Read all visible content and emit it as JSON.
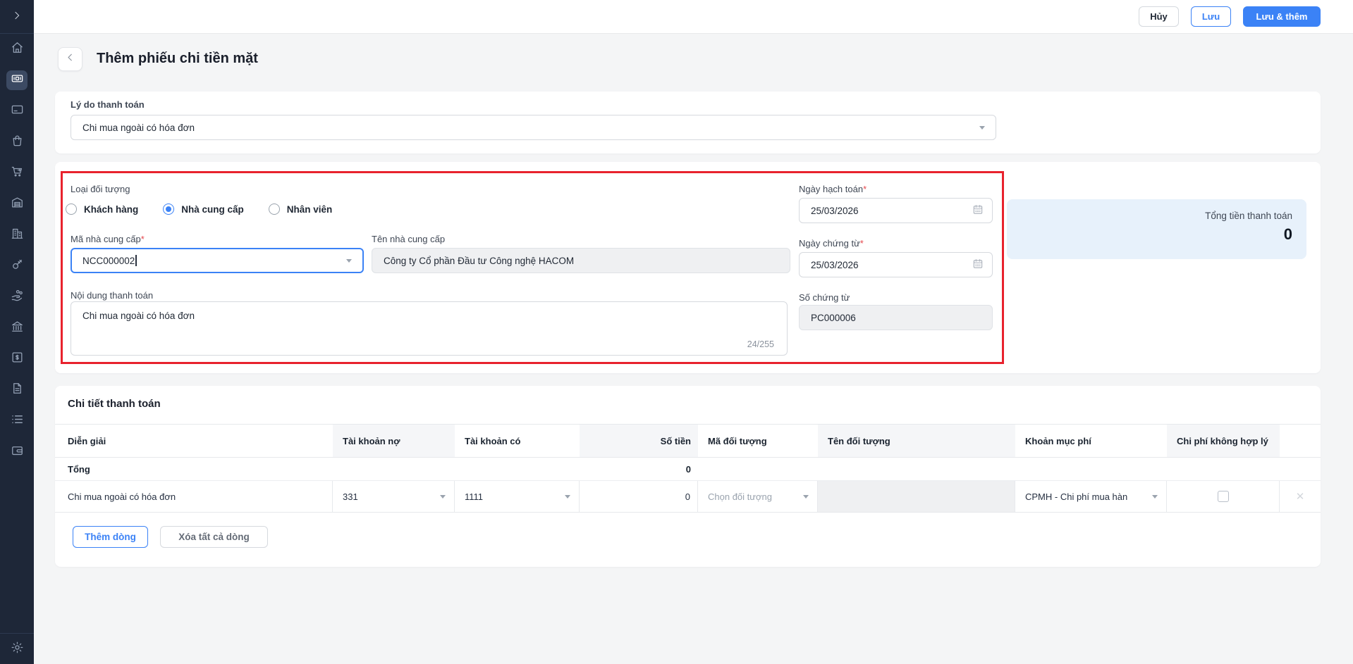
{
  "colors": {
    "accent": "#3b82f6",
    "sidebar_bg": "#1e2738",
    "annotation_red": "#e8222d",
    "total_panel_bg": "#e7f1fb"
  },
  "topbar": {
    "cancel_label": "Hủy",
    "save_label": "Lưu",
    "save_add_label": "Lưu & thêm"
  },
  "page": {
    "title": "Thêm phiếu chi tiền mặt"
  },
  "sidebar": {
    "expand_icon": "chevron-right",
    "items": [
      {
        "icon": "home-icon",
        "active": false
      },
      {
        "icon": "cash-icon",
        "active": true
      },
      {
        "icon": "credit-card-icon",
        "active": false
      },
      {
        "icon": "shopping-bag-icon",
        "active": false
      },
      {
        "icon": "shopping-cart-icon",
        "active": false
      },
      {
        "icon": "warehouse-icon",
        "active": false
      },
      {
        "icon": "building-icon",
        "active": false
      },
      {
        "icon": "key-icon",
        "active": false
      },
      {
        "icon": "hand-coins-icon",
        "active": false
      },
      {
        "icon": "bank-icon",
        "active": false
      },
      {
        "icon": "safe-icon",
        "active": false
      },
      {
        "icon": "document-icon",
        "active": false
      },
      {
        "icon": "list-icon",
        "active": false
      },
      {
        "icon": "wallet-icon",
        "active": false
      }
    ],
    "settings_icon": "gear-icon"
  },
  "reason": {
    "label": "Lý do thanh toán",
    "value": "Chi mua ngoài có hóa đơn"
  },
  "form": {
    "object_type": {
      "label": "Loại đối tượng",
      "options": [
        {
          "label": "Khách hàng",
          "selected": false
        },
        {
          "label": "Nhà cung cấp",
          "selected": true
        },
        {
          "label": "Nhân viên",
          "selected": false
        }
      ]
    },
    "supplier_code": {
      "label": "Mã nhà cung cấp",
      "required_mark": "*",
      "value": "NCC000002"
    },
    "supplier_name": {
      "label": "Tên nhà cung cấp",
      "value": "Công ty Cổ phần Đầu tư Công nghệ HACOM"
    },
    "content": {
      "label": "Nội dung thanh toán",
      "value": "Chi mua ngoài có hóa đơn",
      "counter": "24/255"
    },
    "posting_date": {
      "label": "Ngày hạch toán",
      "required_mark": "*",
      "value": "25/03/2026"
    },
    "document_date": {
      "label": "Ngày chứng từ",
      "required_mark": "*",
      "value": "25/03/2026"
    },
    "document_number": {
      "label": "Số chứng từ",
      "value": "PC000006"
    }
  },
  "total_panel": {
    "label": "Tổng tiền thanh toán",
    "value": "0"
  },
  "details": {
    "title": "Chi tiết thanh toán",
    "columns": [
      "Diễn giải",
      "Tài khoản nợ",
      "Tài khoản có",
      "Số tiền",
      "Mã đối tượng",
      "Tên đối tượng",
      "Khoản mục phí",
      "Chi phí không hợp lý"
    ],
    "total_row": {
      "label": "Tổng",
      "amount": "0"
    },
    "rows": [
      {
        "description": "Chi mua ngoài có hóa đơn",
        "debit_account": "331",
        "credit_account": "1111",
        "amount": "0",
        "object_code_placeholder": "Chọn đối tượng",
        "object_name": "",
        "expense_category": "CPMH - Chi phí mua hàn",
        "invalid_expense_checked": false
      }
    ],
    "add_row_label": "Thêm dòng",
    "clear_rows_label": "Xóa tất cả dòng"
  }
}
